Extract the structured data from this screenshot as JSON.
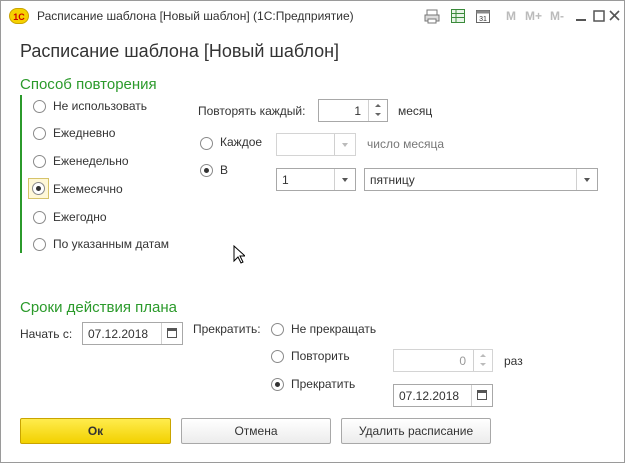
{
  "window": {
    "title": "Расписание шаблона [Новый шаблон]  (1С:Предприятие)",
    "app_icon_text": "1С",
    "toolbar": {
      "m": "M",
      "m_plus": "M+",
      "m_minus": "M-"
    }
  },
  "form": {
    "title": "Расписание шаблона [Новый шаблон]"
  },
  "repeat": {
    "group_title": "Способ повторения",
    "options": [
      "Не использовать",
      "Ежедневно",
      "Еженедельно",
      "Ежемесячно",
      "Ежегодно",
      "По указанным датам"
    ],
    "selected": "Ежемесячно",
    "every_label": "Повторять каждый:",
    "every_value": "1",
    "every_unit": "месяц",
    "each_label": "Каждое",
    "each_value": "",
    "each_suffix": "число месяца",
    "in_label": "В",
    "in_number": "1",
    "in_weekday": "пятницу"
  },
  "period": {
    "group_title": "Сроки действия плана",
    "start_label": "Начать с:",
    "start_date": "07.12.2018",
    "stop_label": "Прекратить:",
    "stop_options": [
      "Не прекращать",
      "Повторить",
      "Прекратить"
    ],
    "stop_selected": "Прекратить",
    "repeat_count": "0",
    "repeat_unit": "раз",
    "stop_date": "07.12.2018"
  },
  "buttons": {
    "ok": "Ок",
    "cancel": "Отмена",
    "delete": "Удалить расписание"
  },
  "colors": {
    "accent_green": "#2b9a2b",
    "primary_yellow": "#f2d100"
  }
}
